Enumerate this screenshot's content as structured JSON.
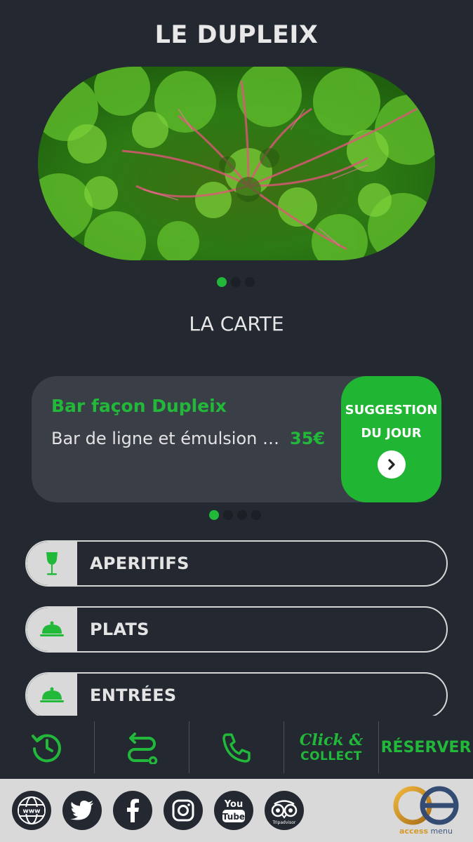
{
  "header": {
    "title": "LE DUPLEIX"
  },
  "carousel": {
    "slide_count": 3,
    "active_index": 0
  },
  "menu_section": {
    "title": "LA CARTE"
  },
  "suggestion": {
    "name": "Bar façon Dupleix",
    "description": "Bar de ligne et émulsion d…",
    "price": "35€",
    "tag_line1": "SUGGESTION",
    "tag_line2": "DU JOUR",
    "pager_count": 4,
    "active_index": 0
  },
  "categories": [
    {
      "label": "APERITIFS",
      "icon": "wine-glass-icon"
    },
    {
      "label": "PLATS",
      "icon": "cloche-icon"
    },
    {
      "label": "ENTRÉES",
      "icon": "cloche-icon"
    }
  ],
  "actions": {
    "history_icon": "history-clock-icon",
    "route_icon": "route-icon",
    "phone_icon": "phone-icon",
    "click_collect_line1": "Click &",
    "click_collect_line2": "COLLECT",
    "reserve_label": "RÉSERVER"
  },
  "footer": {
    "www_label": "www",
    "youtube_line1": "You",
    "youtube_line2": "Tube",
    "tripadvisor_label": "Tripadvisor",
    "logo_text_a": "access",
    "logo_text_b": "menu"
  },
  "colors": {
    "accent": "#22b83a",
    "background": "#232831",
    "card": "#3a3e47",
    "footer": "#d9d9d9"
  }
}
